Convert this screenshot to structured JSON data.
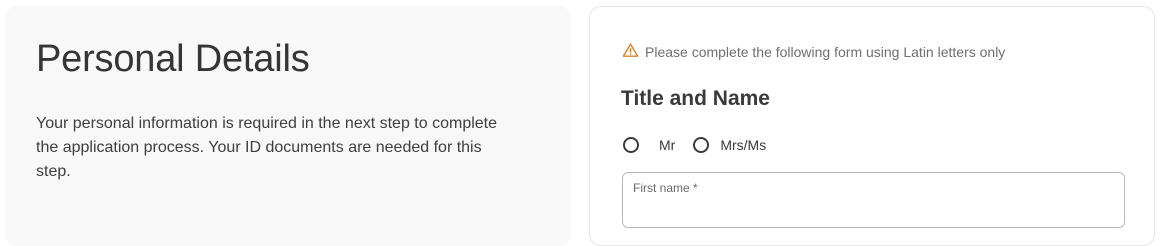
{
  "intro": {
    "title": "Personal Details",
    "description": "Your personal information is required in the next step to complete the application process. Your ID documents are needed for this step."
  },
  "form": {
    "notice": "Please complete the following form using Latin letters only",
    "notice_icon": "warning-triangle-icon",
    "notice_icon_color": "#d9822b",
    "section_title": "Title and Name",
    "title_options": [
      "Mr",
      "Mrs/Ms"
    ],
    "first_name": {
      "label": "First name *",
      "value": ""
    }
  }
}
